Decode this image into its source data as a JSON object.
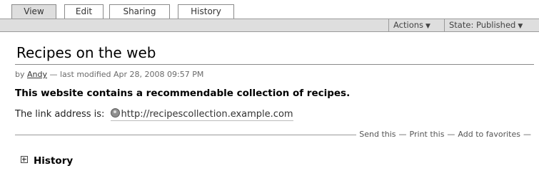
{
  "tabs": [
    {
      "label": "View",
      "active": true
    },
    {
      "label": "Edit",
      "active": false
    },
    {
      "label": "Sharing",
      "active": false
    },
    {
      "label": "History",
      "active": false
    }
  ],
  "actionbar": {
    "actions_label": "Actions",
    "state_label": "State: Published",
    "arrow": "▼"
  },
  "content": {
    "title": "Recipes on the web",
    "byline": {
      "prefix": "by",
      "author": "Andy",
      "modified": "— last modified Apr 28, 2008 09:57 PM"
    },
    "description": "This website contains a recommendable collection of recipes.",
    "link": {
      "label": "The link address is:",
      "url": "http://recipescollection.example.com"
    },
    "document_actions": {
      "send": "Send this",
      "print": "Print this",
      "favorites": "Add to favorites",
      "separator": "—"
    },
    "history_label": "History"
  },
  "colors": {
    "tab_active_bg": "#dedede",
    "bar_bg": "#dedede",
    "border": "#9a9a9a"
  },
  "icons": {
    "link_icon": "globe-icon",
    "history_toggle": "plus-box-icon"
  }
}
